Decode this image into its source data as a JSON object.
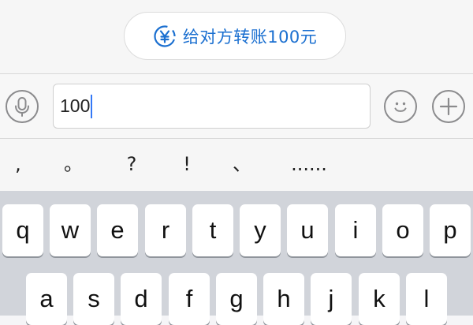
{
  "transfer_suggestion": {
    "label": "给对方转账100元",
    "icon": "yen-circle-icon",
    "accent_color": "#1a6fd0"
  },
  "input_bar": {
    "voice_icon": "microphone-icon",
    "text_value": "100",
    "emoji_icon": "smiley-icon",
    "more_icon": "plus-circle-icon",
    "caret_color": "#3478f6"
  },
  "punctuation_row": [
    ",",
    "。",
    "?",
    "!",
    "、",
    "......"
  ],
  "keyboard": {
    "row1": [
      "q",
      "w",
      "e",
      "r",
      "t",
      "y",
      "u",
      "i",
      "o",
      "p"
    ],
    "row2": [
      "a",
      "s",
      "d",
      "f",
      "g",
      "h",
      "j",
      "k",
      "l"
    ]
  }
}
